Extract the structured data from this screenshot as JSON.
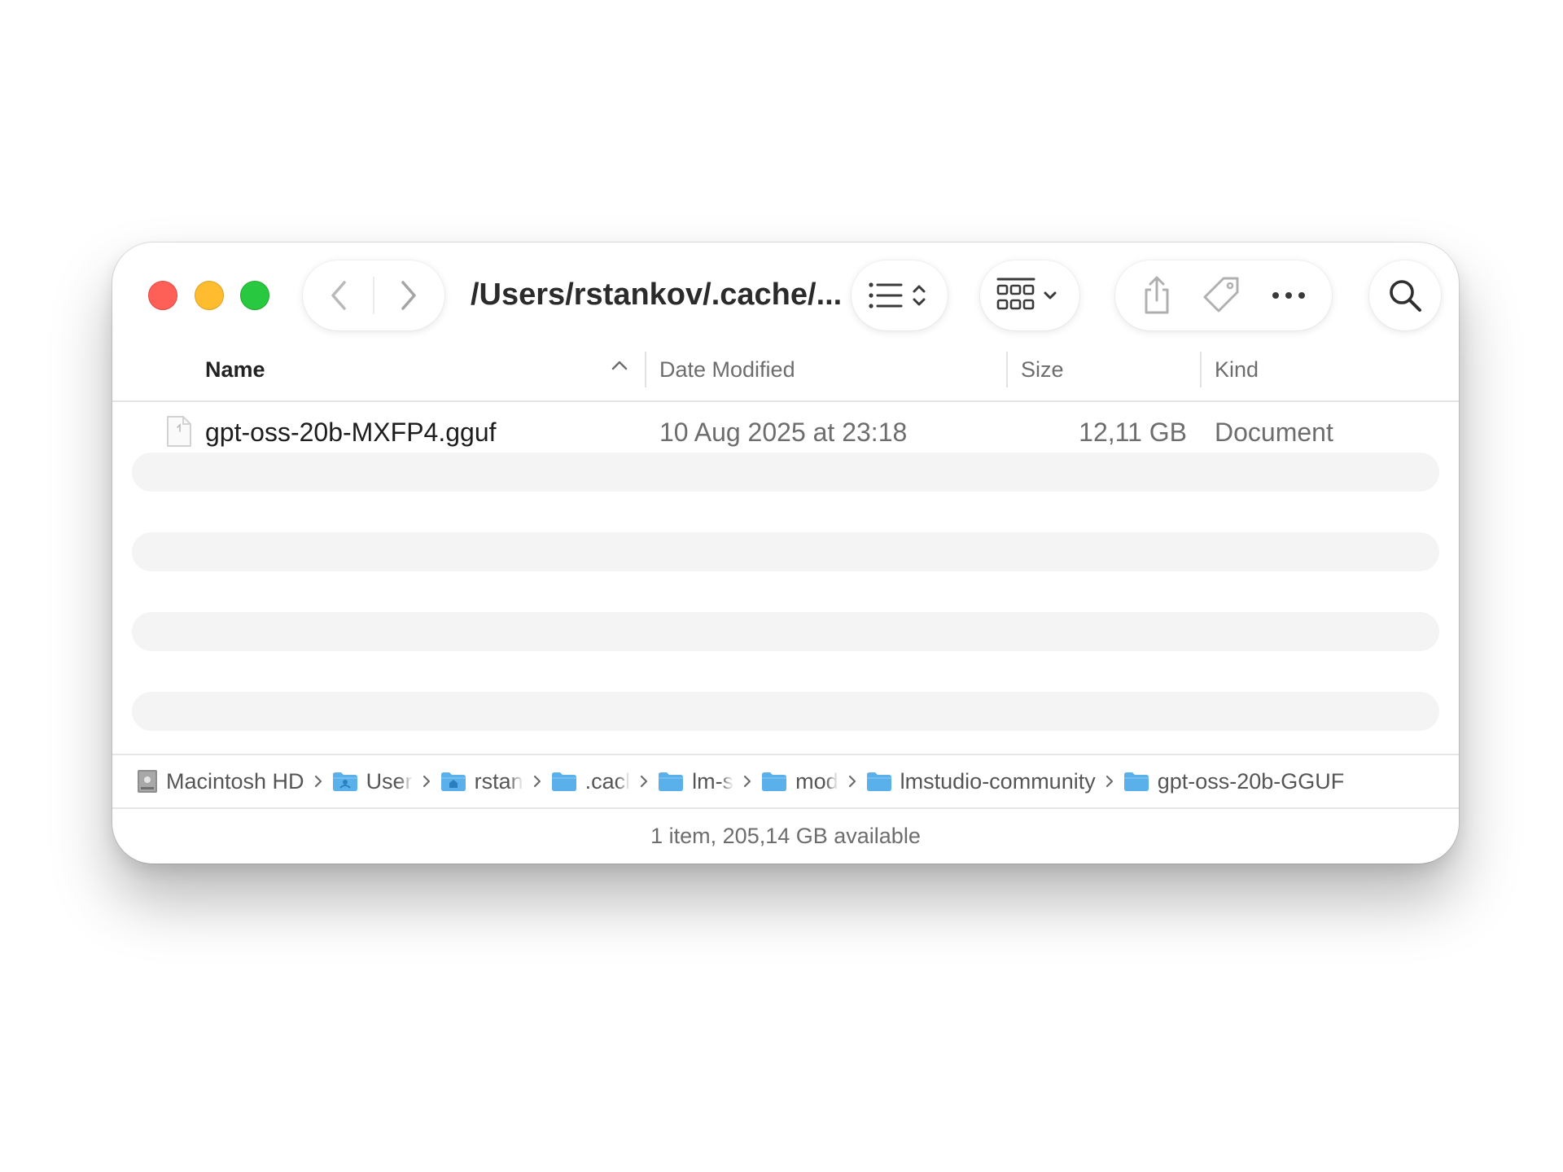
{
  "window": {
    "path_title": "/Users/rstankov/.cache/...",
    "traffic_lights": {
      "close": "#fe5f57",
      "minimize": "#febc2e",
      "maximize": "#28c840"
    }
  },
  "toolbar": {
    "back_icon": "chevron-left-icon",
    "forward_icon": "chevron-right-icon",
    "view_icon": "list-view-icon",
    "group_icon": "grid-group-icon",
    "share_icon": "share-icon",
    "tag_icon": "tag-icon",
    "more_icon": "ellipsis-icon",
    "search_icon": "search-icon"
  },
  "columns": {
    "name": "Name",
    "date": "Date Modified",
    "size": "Size",
    "kind": "Kind"
  },
  "files": [
    {
      "name": "gpt-oss-20b-MXFP4.gguf",
      "date": "10 Aug 2025 at 23:18",
      "size": "12,11 GB",
      "kind": "Document"
    }
  ],
  "pathbar": {
    "items": [
      {
        "label": "Macintosh HD",
        "icon": "hard-drive-icon"
      },
      {
        "label": "User",
        "icon": "users-folder-icon"
      },
      {
        "label": "rstan",
        "icon": "home-folder-icon"
      },
      {
        "label": ".cacl",
        "icon": "folder-icon"
      },
      {
        "label": "lm-s",
        "icon": "folder-icon"
      },
      {
        "label": "mod",
        "icon": "folder-icon"
      },
      {
        "label": "lmstudio-community",
        "icon": "folder-icon"
      },
      {
        "label": "gpt-oss-20b-GGUF",
        "icon": "folder-icon"
      }
    ]
  },
  "status": {
    "text": "1 item, 205,14 GB available"
  },
  "colors": {
    "folder": "#5ab0ea",
    "accent_text": "#1d1d1f",
    "secondary_text": "#6d6d6d"
  }
}
